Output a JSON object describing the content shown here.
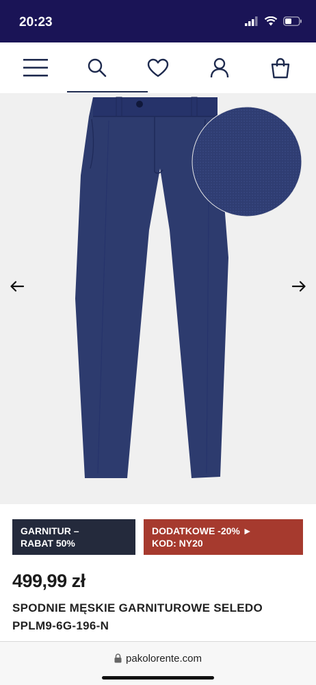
{
  "status_bar": {
    "time": "20:23"
  },
  "promos": {
    "left": {
      "line1": "GARNITUR –",
      "line2": "RABAT 50%"
    },
    "right": {
      "line1": "DODATKOWE -20% ►",
      "line2": "KOD: NY20"
    }
  },
  "product": {
    "price": "499,99 zł",
    "name_line1": "SPODNIE MĘSKIE GARNITUROWE SELEDO",
    "name_line2": "PPLM9-6G-196-N"
  },
  "browser": {
    "url": "pakolorente.com"
  },
  "icons": {
    "menu": "menu-icon",
    "search": "search-icon",
    "wishlist": "heart-icon",
    "account": "user-icon",
    "cart": "bag-icon",
    "prev": "arrow-left-icon",
    "next": "arrow-right-icon",
    "lock": "lock-icon"
  },
  "colors": {
    "status_bar": "#1a1456",
    "promo_dark": "#242a3c",
    "promo_red": "#a63a2e",
    "trousers": "#2d3b6e"
  }
}
